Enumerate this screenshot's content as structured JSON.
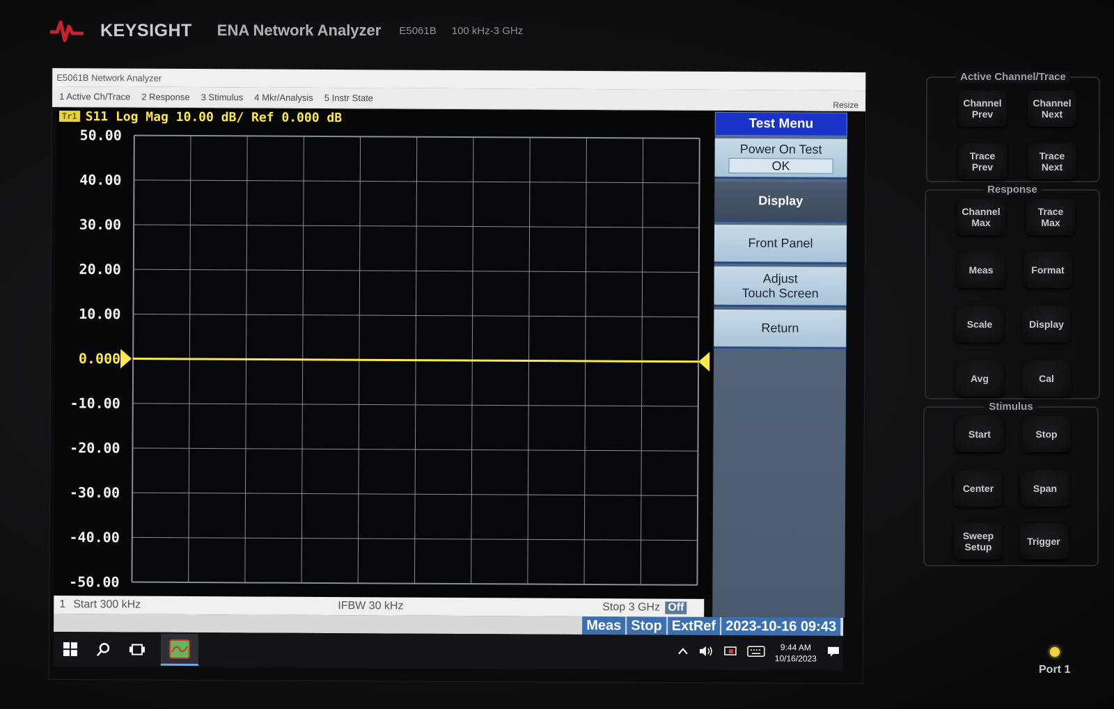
{
  "bezel": {
    "brand": "KEYSIGHT",
    "title": "ENA Network Analyzer",
    "model": "E5061B",
    "range": "100 kHz-3 GHz"
  },
  "window": {
    "title": "E5061B Network Analyzer",
    "menu": [
      "1 Active Ch/Trace",
      "2 Response",
      "3 Stimulus",
      "4 Mkr/Analysis",
      "5 Instr State"
    ],
    "resize": "Resize"
  },
  "trace": {
    "tag": "Tr1",
    "label": "S11 Log Mag 10.00 dB/ Ref 0.000 dB",
    "color": "#ffe94a"
  },
  "chart_data": {
    "type": "line",
    "ylabel_ticks": [
      "50.00",
      "40.00",
      "30.00",
      "20.00",
      "10.00",
      "0.000",
      "-10.00",
      "-20.00",
      "-30.00",
      "-40.00",
      "-50.00"
    ],
    "ylim": [
      -50,
      50
    ],
    "x_divisions": 10,
    "y_divisions": 10,
    "reference_value": 0,
    "series": [
      {
        "x": [
          0,
          1
        ],
        "values": [
          0,
          0
        ]
      }
    ],
    "grid": true
  },
  "footer": {
    "channel": "1",
    "start": "Start 300 kHz",
    "ifbw": "IFBW 30 kHz",
    "stop": "Stop 3 GHz",
    "off": "Off"
  },
  "status": {
    "meas": "Meas",
    "stop": "Stop",
    "extref": "ExtRef",
    "datetime": "2023-10-16 09:43"
  },
  "taskbar": {
    "time": "9:44 AM",
    "date": "10/16/2023"
  },
  "softkeys": {
    "title": "Test Menu",
    "power_on_test": "Power On Test",
    "power_on_result": "OK",
    "display": "Display",
    "front_panel": "Front Panel",
    "adjust_line1": "Adjust",
    "adjust_line2": "Touch Screen",
    "return": "Return"
  },
  "hardware": {
    "active_group": "Active Channel/Trace",
    "channel_prev": [
      "Channel",
      "Prev"
    ],
    "channel_next": [
      "Channel",
      "Next"
    ],
    "trace_prev": [
      "Trace",
      "Prev"
    ],
    "trace_next": [
      "Trace",
      "Next"
    ],
    "response_group": "Response",
    "channel_max": [
      "Channel",
      "Max"
    ],
    "trace_max": [
      "Trace",
      "Max"
    ],
    "meas": "Meas",
    "format": "Format",
    "scale": "Scale",
    "display": "Display",
    "avg": "Avg",
    "cal": "Cal",
    "stimulus_group": "Stimulus",
    "start": "Start",
    "stop": "Stop",
    "center": "Center",
    "span": "Span",
    "sweep_setup": [
      "Sweep",
      "Setup"
    ],
    "trigger": "Trigger",
    "port": "Port 1"
  }
}
